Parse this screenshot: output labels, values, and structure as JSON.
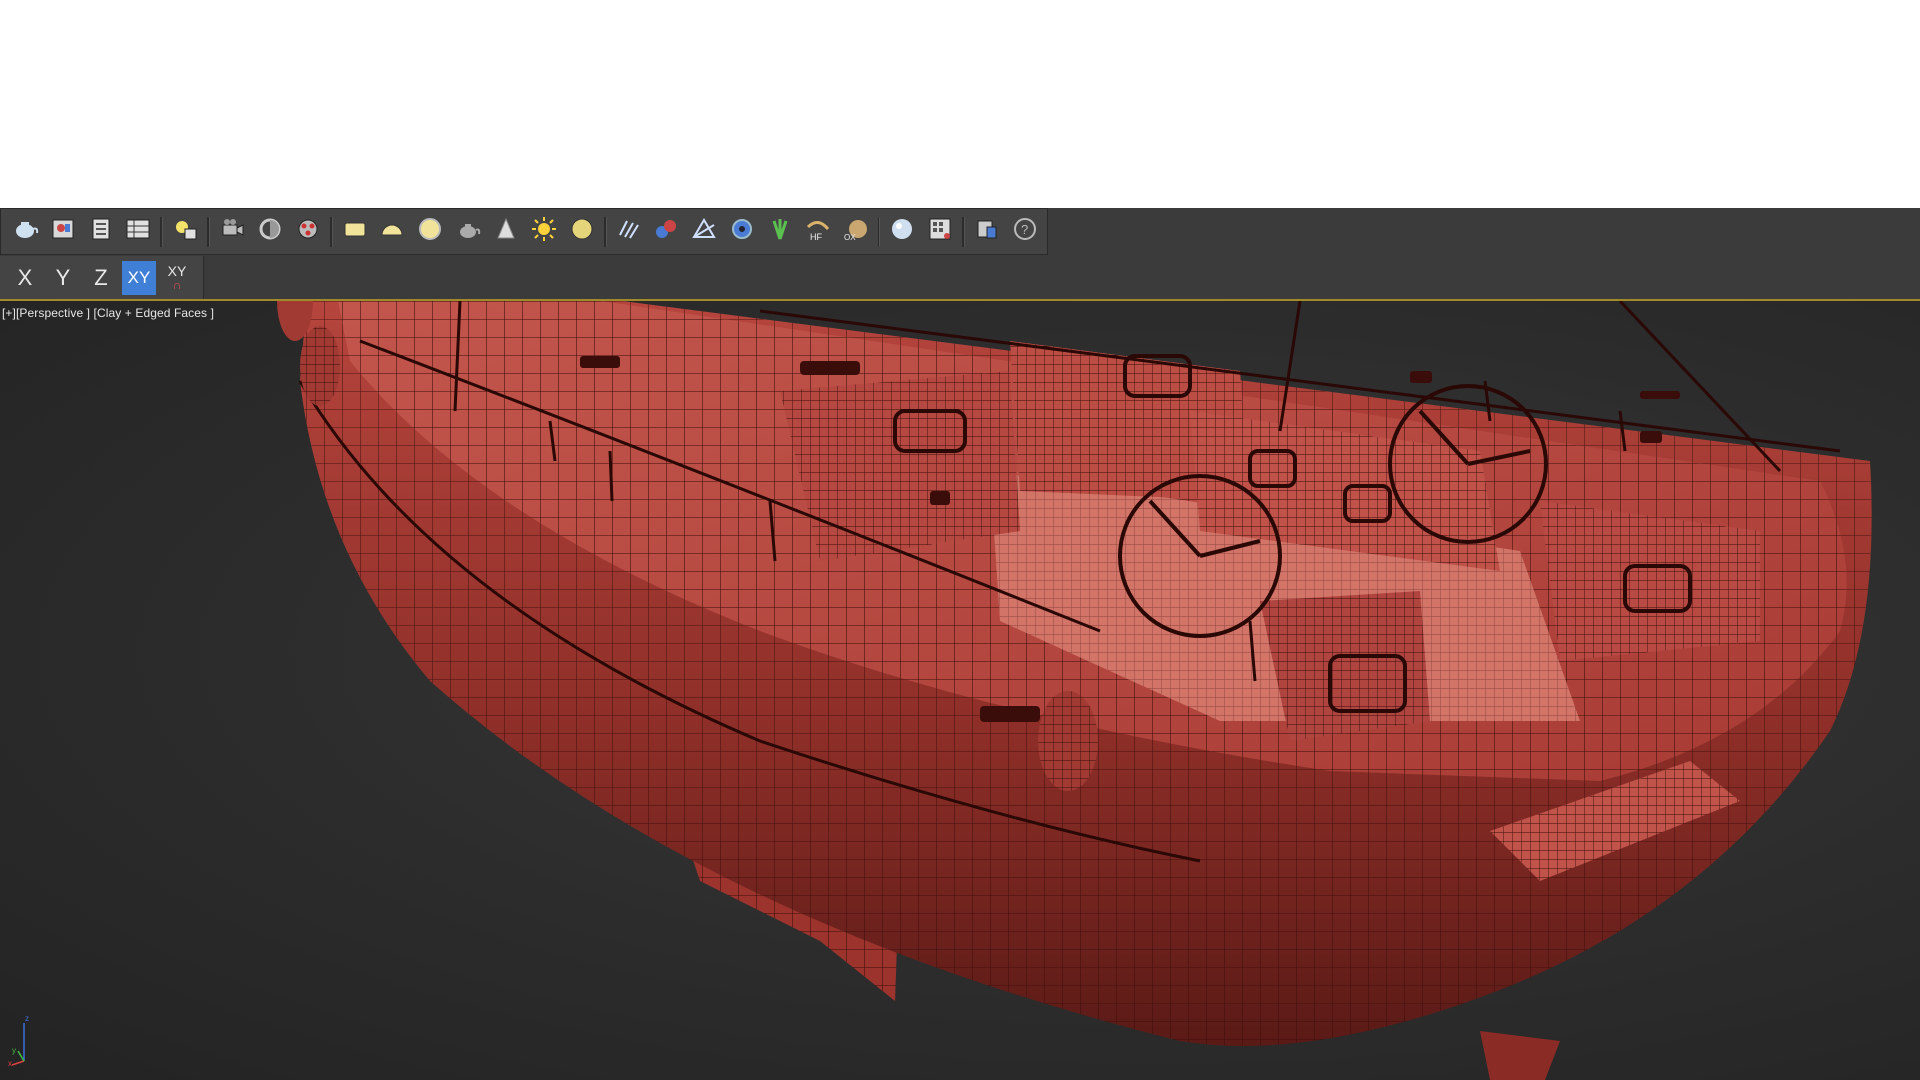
{
  "toolbar": {
    "icons": [
      "teapot-render-icon",
      "rendered-frame-window-icon",
      "render-setup-icon",
      "render-setup-table-icon",
      "separator",
      "environment-light-icon",
      "separator",
      "camera-sequence-icon",
      "render-in-cloud-icon",
      "video-post-icon",
      "separator",
      "plane-primitive-icon",
      "hemisphere-icon",
      "sphere-icon",
      "teapot-primitive-icon",
      "cone-icon",
      "sun-light-icon",
      "omni-sphere-icon",
      "separator",
      "hair-fur-icon",
      "particle-flow-icon",
      "cloth-icon",
      "gear-modifier-icon",
      "grass-icon",
      "hf-hair-icon",
      "ox-shell-icon",
      "separator",
      "material-sphere-icon",
      "material-editor-icon",
      "separator",
      "scene-explorer-icon",
      "help-icon"
    ]
  },
  "axis_constraints": {
    "x_label": "X",
    "y_label": "Y",
    "z_label": "Z",
    "xy_label": "XY",
    "xy_lock_label": "XY"
  },
  "viewport": {
    "plus_label": "[+]",
    "view_label": "[Perspective ]",
    "shading_label": "[Clay + Edged Faces ]"
  },
  "gizmo": {
    "z": "z",
    "y": "y",
    "x": "x"
  },
  "colors": {
    "toolbar_bg": "#444444",
    "viewport_bg": "#2c2c2c",
    "active_axis": "#3f7fd6",
    "clay": "#b8463f"
  }
}
